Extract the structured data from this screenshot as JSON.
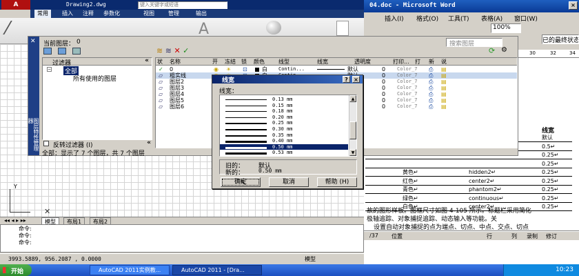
{
  "autocad": {
    "title": "Drawing2.dwg",
    "search_placeholder": "键入关键字或短语",
    "ribbon_tabs": [
      "常用",
      "插入",
      "注释",
      "参数化",
      "视图",
      "管理",
      "输出"
    ],
    "tool_label": "直线",
    "layout_tabs": [
      "模型",
      "布局1",
      "布局2"
    ],
    "command_lines": [
      "命令:",
      "命令:",
      "命令:"
    ],
    "coords": "3993.5889, 956.2087 , 0.0000",
    "status_model": "模型"
  },
  "word": {
    "title": "04.doc - Microsoft Word",
    "menu": [
      "插入(I)",
      "格式(O)",
      "工具(T)",
      "表格(A)",
      "窗口(W)"
    ],
    "zoom": "100%",
    "right_snippet": "已的最终状态",
    "ruler": [
      "30",
      "32",
      "34"
    ],
    "table_header": "线宽",
    "table_rows": [
      {
        "color": "",
        "linetype": "",
        "width": "默认"
      },
      {
        "color": "",
        "linetype": "",
        "width": "0.5↵"
      },
      {
        "color": "",
        "linetype": "",
        "width": "0.25↵"
      },
      {
        "color": "",
        "linetype": "",
        "width": "0.25↵"
      },
      {
        "color": "黄色↵",
        "linetype": "hidden2↵",
        "width": "0.25↵"
      },
      {
        "color": "红色↵",
        "linetype": "center2↵",
        "width": "0.25↵"
      },
      {
        "color": "青色↵",
        "linetype": "phantom2↵",
        "width": "0.25↵"
      },
      {
        "color": "绿色↵",
        "linetype": "continuous↵",
        "width": "0.25↵"
      },
      {
        "color": "白色↵",
        "linetype": "center2↵",
        "width": "0.25↵"
      }
    ],
    "body_lines": [
      "故的图形样板。图框尺寸如图 4-105 所示。标题栏采用简化",
      "极轴追踪、对象捕捉追踪、动态输入等功能。关",
      "设置自动对象捕捉的点为端点、切点、中点、交点、切点"
    ],
    "status_page": "/37",
    "status_pos": "位置",
    "status_items": [
      "行",
      "列",
      "录制",
      "修订"
    ]
  },
  "layer_manager": {
    "current_layer_label": "当前图层：",
    "current_layer": "0",
    "search_placeholder": "搜索图层",
    "filters_header": "过滤器",
    "filter_all": "全部",
    "filter_used": "所有使用的图层",
    "invert_filter": "反转过滤器 (I)",
    "side_label": "图层特性管理器",
    "columns": [
      "状",
      "名称",
      "开",
      "冻结",
      "锁",
      "颜色",
      "线型",
      "线宽",
      "透明度",
      "打印...",
      "打",
      "新",
      "说"
    ],
    "layers": [
      {
        "name": "0",
        "color": "白",
        "linetype": "Contin...",
        "lineweight": "默认",
        "transparency": "0",
        "plot_style": "Color_7"
      },
      {
        "name": "粗实线",
        "color": "白",
        "linetype": "Contin...",
        "lineweight": "默认",
        "transparency": "0",
        "plot_style": "Color_7"
      },
      {
        "name": "图层2",
        "color": "",
        "linetype": "",
        "lineweight": "默认",
        "transparency": "0",
        "plot_style": "Color_7"
      },
      {
        "name": "图层3",
        "color": "",
        "linetype": "",
        "lineweight": "默认",
        "transparency": "0",
        "plot_style": "Color_7"
      },
      {
        "name": "图层4",
        "color": "",
        "linetype": "",
        "lineweight": "默认",
        "transparency": "0",
        "plot_style": "Color_7"
      },
      {
        "name": "图层5",
        "color": "",
        "linetype": "",
        "lineweight": "默认",
        "transparency": "0",
        "plot_style": "Color_7"
      },
      {
        "name": "图层6",
        "color": "",
        "linetype": "",
        "lineweight": "默认",
        "transparency": "0",
        "plot_style": "Color_7"
      }
    ],
    "status_text": "全部：显示了 7 个图层，共 7 个图层"
  },
  "lineweight_dialog": {
    "title": "线宽",
    "list_label": "线宽：",
    "items": [
      "0.13 mm",
      "0.15 mm",
      "0.18 mm",
      "0.20 mm",
      "0.25 mm",
      "0.30 mm",
      "0.35 mm",
      "0.40 mm",
      "0.50 mm",
      "0.53 mm"
    ],
    "selected_index": 8,
    "old_label": "旧的：",
    "old_value": "默认",
    "new_label": "新的：",
    "new_value": "0.50 mm",
    "ok": "确定",
    "cancel": "取消",
    "help": "帮助 (H)"
  },
  "taskbar": {
    "start": "开始",
    "tasks": [
      "AutoCAD 2011实例教...",
      "AutoCAD 2011 - [Dra..."
    ],
    "clock": "10:23"
  },
  "colors": {
    "title_blue": "#0a3a96",
    "selection": "#0a246a",
    "panel": "#d4d0c8",
    "taskbar": "#245edb",
    "start_green": "#3a9a3a"
  }
}
